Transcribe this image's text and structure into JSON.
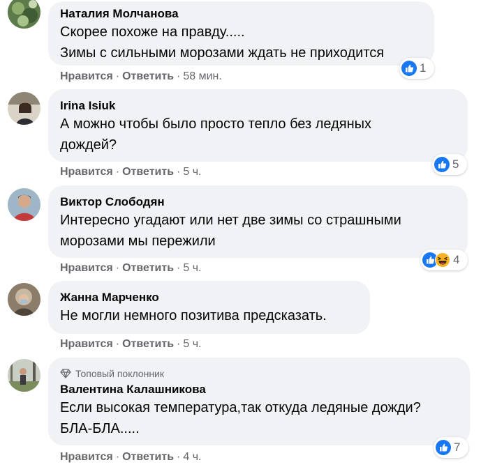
{
  "colors": {
    "like_blue": "#1877f2",
    "haha_yellow": "#f7b125",
    "bubble_bg": "#f0f2f5",
    "meta_gray": "#65676b"
  },
  "comments": [
    {
      "author": "Наталия Молчанова",
      "lines": "Скорее похоже на правду.....\nЗимы с сильными морозами ждать не приходится",
      "like_label": "Нравится",
      "reply_label": "Ответить",
      "time": "58 мин.",
      "reaction_icons": [
        "like-icon"
      ],
      "reaction_count": "1"
    },
    {
      "author": "Irina Isiuk",
      "lines": "А можно чтобы было просто тепло без ледяных\nдождей?",
      "like_label": "Нравится",
      "reply_label": "Ответить",
      "time": "5 ч.",
      "reaction_icons": [
        "like-icon"
      ],
      "reaction_count": "5"
    },
    {
      "author": "Виктор Слободян",
      "lines": "Интересно угадают или нет две зимы со страшными\nморозами мы пережили",
      "like_label": "Нравится",
      "reply_label": "Ответить",
      "time": "5 ч.",
      "reaction_icons": [
        "like-icon",
        "haha-icon"
      ],
      "reaction_count": "4"
    },
    {
      "author": "Жанна Марченко",
      "lines": "Не могли немного позитива предсказать.",
      "like_label": "Нравится",
      "reply_label": "Ответить",
      "time": "5 ч."
    },
    {
      "badge": "Топовый поклонник",
      "author": "Валентина Калашникова",
      "lines": "Если высокая температура,так откуда ледяные дожди?\nБЛА-БЛА.....",
      "like_label": "Нравится",
      "reply_label": "Ответить",
      "time": "4 ч.",
      "reaction_icons": [
        "like-icon"
      ],
      "reaction_count": "7"
    }
  ]
}
